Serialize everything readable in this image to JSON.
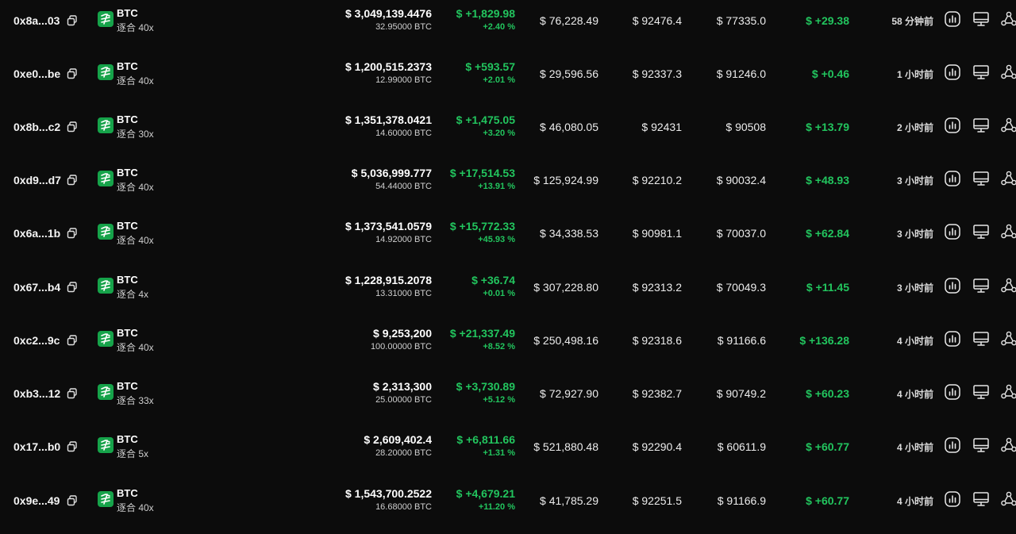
{
  "brand_color": "#16a34a",
  "profit_color": "#22c55e",
  "icons": {
    "copy": "copy-icon",
    "asset": "btc-logo-icon",
    "chart": "chart-icon",
    "screen": "monitor-icon",
    "share": "share-icon"
  },
  "rows": [
    {
      "address": "0x8a...03",
      "asset": "BTC",
      "leverage": "逐合 40x",
      "value": "$ 3,049,139.4476",
      "quantity": "32.95000 BTC",
      "pnl": "$ +1,829.98",
      "pnl_pct": "+2.40 %",
      "margin": "$ 76,228.49",
      "entry": "$ 92476.4",
      "liq": "$ 77335.0",
      "funding": "$ +29.38",
      "time": "58 分钟前"
    },
    {
      "address": "0xe0...be",
      "asset": "BTC",
      "leverage": "逐合 40x",
      "value": "$ 1,200,515.2373",
      "quantity": "12.99000 BTC",
      "pnl": "$ +593.57",
      "pnl_pct": "+2.01 %",
      "margin": "$ 29,596.56",
      "entry": "$ 92337.3",
      "liq": "$ 91246.0",
      "funding": "$ +0.46",
      "time": "1 小时前"
    },
    {
      "address": "0x8b...c2",
      "asset": "BTC",
      "leverage": "逐合 30x",
      "value": "$ 1,351,378.0421",
      "quantity": "14.60000 BTC",
      "pnl": "$ +1,475.05",
      "pnl_pct": "+3.20 %",
      "margin": "$ 46,080.05",
      "entry": "$ 92431",
      "liq": "$ 90508",
      "funding": "$ +13.79",
      "time": "2 小时前"
    },
    {
      "address": "0xd9...d7",
      "asset": "BTC",
      "leverage": "逐合 40x",
      "value": "$ 5,036,999.777",
      "quantity": "54.44000 BTC",
      "pnl": "$ +17,514.53",
      "pnl_pct": "+13.91 %",
      "margin": "$ 125,924.99",
      "entry": "$ 92210.2",
      "liq": "$ 90032.4",
      "funding": "$ +48.93",
      "time": "3 小时前"
    },
    {
      "address": "0x6a...1b",
      "asset": "BTC",
      "leverage": "逐合 40x",
      "value": "$ 1,373,541.0579",
      "quantity": "14.92000 BTC",
      "pnl": "$ +15,772.33",
      "pnl_pct": "+45.93 %",
      "margin": "$ 34,338.53",
      "entry": "$ 90981.1",
      "liq": "$ 70037.0",
      "funding": "$ +62.84",
      "time": "3 小时前"
    },
    {
      "address": "0x67...b4",
      "asset": "BTC",
      "leverage": "逐合 4x",
      "value": "$ 1,228,915.2078",
      "quantity": "13.31000 BTC",
      "pnl": "$ +36.74",
      "pnl_pct": "+0.01 %",
      "margin": "$ 307,228.80",
      "entry": "$ 92313.2",
      "liq": "$ 70049.3",
      "funding": "$ +11.45",
      "time": "3 小时前"
    },
    {
      "address": "0xc2...9c",
      "asset": "BTC",
      "leverage": "逐合 40x",
      "value": "$ 9,253,200",
      "quantity": "100.00000 BTC",
      "pnl": "$ +21,337.49",
      "pnl_pct": "+8.52 %",
      "margin": "$ 250,498.16",
      "entry": "$ 92318.6",
      "liq": "$ 91166.6",
      "funding": "$ +136.28",
      "time": "4 小时前"
    },
    {
      "address": "0xb3...12",
      "asset": "BTC",
      "leverage": "逐合 33x",
      "value": "$ 2,313,300",
      "quantity": "25.00000 BTC",
      "pnl": "$ +3,730.89",
      "pnl_pct": "+5.12 %",
      "margin": "$ 72,927.90",
      "entry": "$ 92382.7",
      "liq": "$ 90749.2",
      "funding": "$ +60.23",
      "time": "4 小时前"
    },
    {
      "address": "0x17...b0",
      "asset": "BTC",
      "leverage": "逐合 5x",
      "value": "$ 2,609,402.4",
      "quantity": "28.20000 BTC",
      "pnl": "$ +6,811.66",
      "pnl_pct": "+1.31 %",
      "margin": "$ 521,880.48",
      "entry": "$ 92290.4",
      "liq": "$ 60611.9",
      "funding": "$ +60.77",
      "time": "4 小时前"
    },
    {
      "address": "0x9e...49",
      "asset": "BTC",
      "leverage": "逐合 40x",
      "value": "$ 1,543,700.2522",
      "quantity": "16.68000 BTC",
      "pnl": "$ +4,679.21",
      "pnl_pct": "+11.20 %",
      "margin": "$ 41,785.29",
      "entry": "$ 92251.5",
      "liq": "$ 91166.9",
      "funding": "$ +60.77",
      "time": "4 小时前"
    }
  ]
}
